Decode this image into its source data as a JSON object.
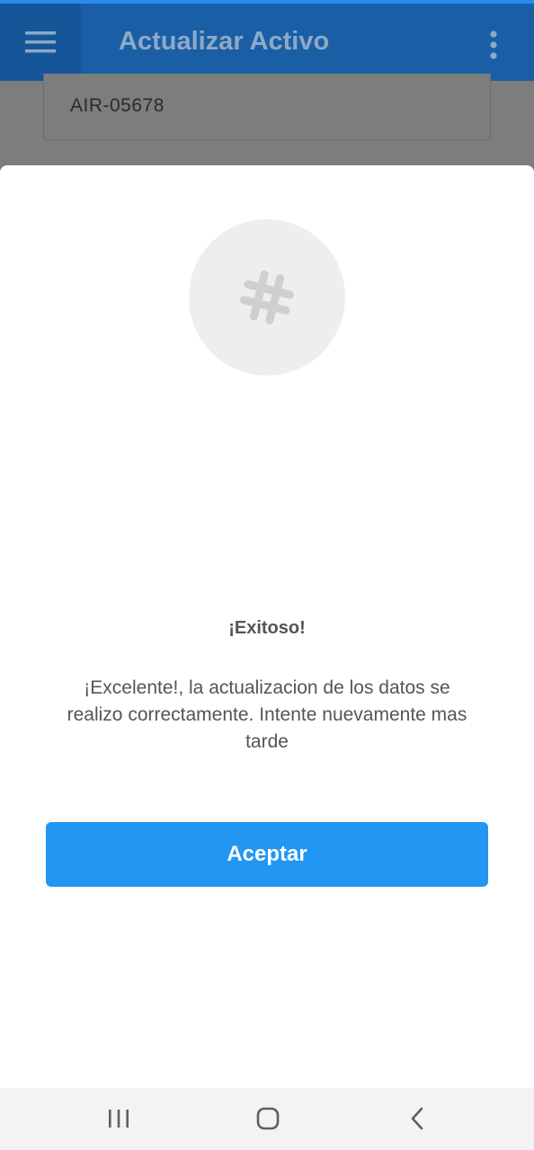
{
  "app_bar": {
    "title": "Actualizar Activo",
    "menu_icon": "hamburger-menu-icon",
    "overflow_icon": "more-vertical-icon",
    "colors": {
      "background": "#1a5fa6",
      "accent": "#2a8bef"
    }
  },
  "asset_field": {
    "value": "AIR-05678"
  },
  "dialog": {
    "icon": "hashtag-icon",
    "title": "¡Exitoso!",
    "message": "¡Excelente!, la actualizacion de los datos se realizo correctamente. Intente nuevamente mas tarde",
    "accept_label": "Aceptar",
    "colors": {
      "button": "#2196f3",
      "text": "#555555"
    }
  },
  "nav_bar": {
    "recents_icon": "recent-apps-icon",
    "home_icon": "home-icon",
    "back_icon": "back-icon"
  }
}
